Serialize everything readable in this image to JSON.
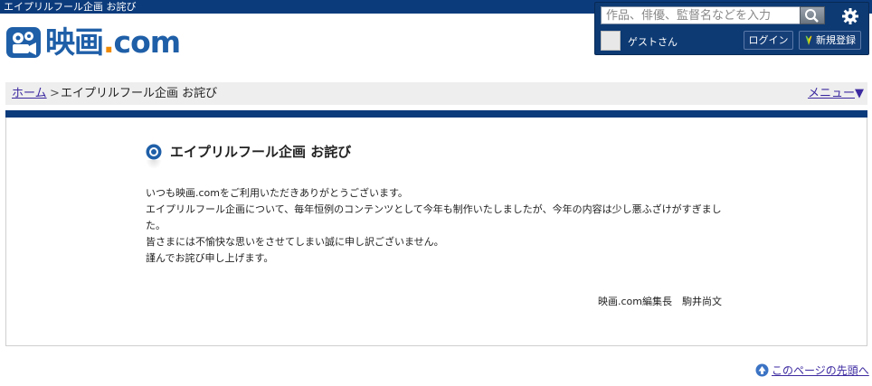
{
  "window_title": "エイプリルフール企画 お詫び",
  "site": {
    "logo_main": "映画",
    "logo_dot": ".",
    "logo_tld": "com"
  },
  "header": {
    "search_placeholder": "作品、俳優、監督名などを入力",
    "guest_label": "ゲストさん",
    "login_label": "ログイン",
    "register_label": "新規登録"
  },
  "breadcrumb": {
    "home": "ホーム",
    "separator": ">",
    "current": "エイプリルフール企画 お詫び"
  },
  "menu_label": "メニュー",
  "menu_arrow": "▼",
  "article": {
    "title": "エイプリルフール企画 お詫び",
    "paragraphs": [
      "いつも映画.comをご利用いただきありがとうございます。",
      "エイプリルフール企画について、毎年恒例のコンテンツとして今年も制作いたしましたが、今年の内容は少し悪ふざけがすぎました。",
      "皆さまには不愉快な思いをさせてしまい誠に申し訳ございません。",
      "謹んでお詫び申し上げます。"
    ],
    "signature": "映画.com編集長　駒井尚文"
  },
  "footer": {
    "to_top_label": "このページの先頭へ"
  },
  "colors": {
    "navy": "#0c3b7c",
    "logo_blue": "#1f5fa8",
    "logo_orange": "#f08a00",
    "link": "#3c2aa0"
  },
  "icons": [
    "search-icon",
    "gear-icon",
    "leaf-icon",
    "title-bullet-icon",
    "up-arrow-icon"
  ]
}
